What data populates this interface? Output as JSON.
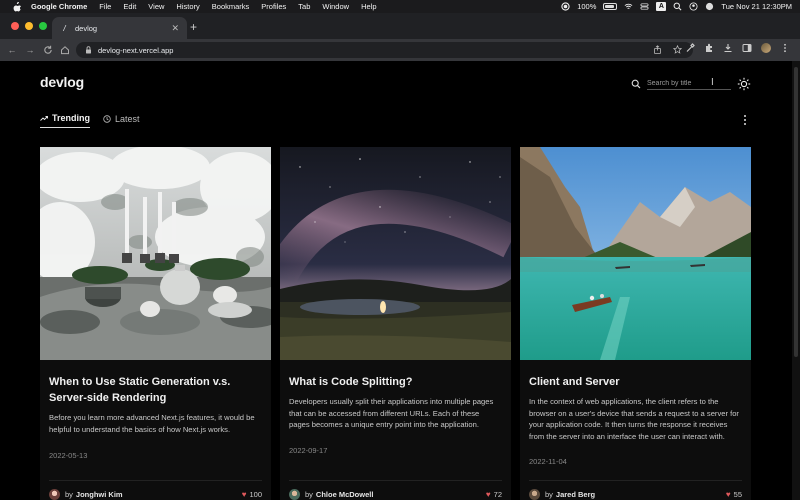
{
  "menubar": {
    "app_name": "Google Chrome",
    "items": [
      "File",
      "Edit",
      "View",
      "History",
      "Bookmarks",
      "Profiles",
      "Tab",
      "Window",
      "Help"
    ],
    "battery": "100%",
    "datetime": "Tue Nov 21  12:30PM"
  },
  "browser": {
    "tab_title": "devlog",
    "url": "devlog-next.vercel.app"
  },
  "site": {
    "logo": "devlog",
    "search_placeholder": "Search by title",
    "tabs": [
      {
        "label": "Trending",
        "active": true
      },
      {
        "label": "Latest",
        "active": false
      }
    ]
  },
  "posts": [
    {
      "title": "When to Use Static Generation v.s. Server-side Rendering",
      "excerpt": "Before you learn more advanced Next.js features, it would be helpful to understand the basics of how Next.js works.",
      "date": "2022-05-13",
      "author": "Jonghwi Kim",
      "likes": "100"
    },
    {
      "title": "What is Code Splitting?",
      "excerpt": "Developers usually split their applications into multiple pages that can be accessed from different URLs. Each of these pages becomes a unique entry point into the application.",
      "date": "2022-09-17",
      "author": "Chloe McDowell",
      "likes": "72"
    },
    {
      "title": "Client and Server",
      "excerpt": "In the context of web applications, the client refers to the browser on a user's device that sends a request to a server for your application code. It then turns the response it receives from the server into an interface the user can interact with.",
      "date": "2022-11-04",
      "author": "Jared Berg",
      "likes": "55"
    }
  ],
  "by_label": "by",
  "colors": {
    "background": "#000000",
    "card": "#0d0d0d",
    "heart": "#e0595c"
  }
}
